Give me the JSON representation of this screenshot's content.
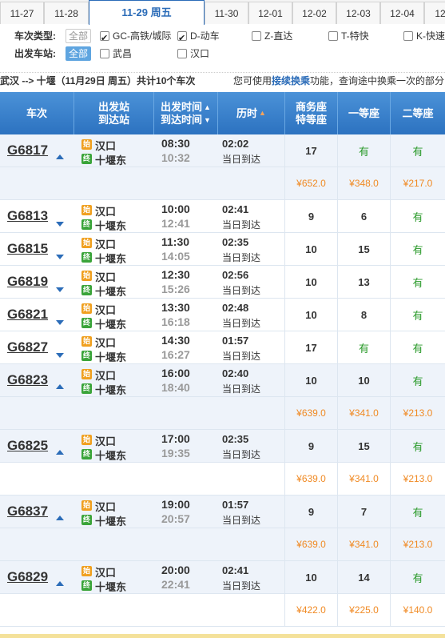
{
  "date_tabs": [
    {
      "label": "11-27",
      "active": false
    },
    {
      "label": "11-28",
      "active": false
    },
    {
      "label": "11-29 周五",
      "active": true
    },
    {
      "label": "11-30",
      "active": false
    },
    {
      "label": "12-01",
      "active": false
    },
    {
      "label": "12-02",
      "active": false
    },
    {
      "label": "12-03",
      "active": false
    },
    {
      "label": "12-04",
      "active": false
    },
    {
      "label": "12",
      "active": false
    }
  ],
  "filters": {
    "type_label": "车次类型:",
    "all_label": "全部",
    "types": [
      {
        "label": "GC-高铁/城际",
        "checked": true
      },
      {
        "label": "D-动车",
        "checked": true
      },
      {
        "label": "Z-直达",
        "checked": false
      },
      {
        "label": "T-特快",
        "checked": false
      },
      {
        "label": "K-快速",
        "checked": false
      }
    ],
    "station_label": "出发车站:",
    "station_all_label": "全部",
    "stations": [
      {
        "label": "武昌",
        "checked": false
      },
      {
        "label": "汉口",
        "checked": false
      }
    ]
  },
  "route": {
    "prefix": "武汉 --> 十堰（11月29日  周五）共计",
    "count": "10",
    "suffix": "个车次",
    "hint_pre": "您可使用",
    "hint_link": "接续换乘",
    "hint_post": "功能，查询途中换乘一次的部分"
  },
  "table": {
    "headers": {
      "train": "车次",
      "station_1": "出发站",
      "station_2": "到达站",
      "time_1": "出发时间",
      "time_2": "到达时间",
      "duration": "历时",
      "business_1": "商务座",
      "business_2": "特等座",
      "first": "一等座",
      "second": "二等座"
    },
    "trains": [
      {
        "no": "G6817",
        "arrow": "up",
        "from": "汉口",
        "to": "十堰东",
        "dep": "08:30",
        "arr": "10:32",
        "dur": "02:02",
        "day": "当日到达",
        "business": "17",
        "first": "有",
        "second": "有",
        "prices": [
          "¥652.0",
          "¥348.0",
          "¥217.0"
        ]
      },
      {
        "no": "G6813",
        "arrow": "down",
        "from": "汉口",
        "to": "十堰东",
        "dep": "10:00",
        "arr": "12:41",
        "dur": "02:41",
        "day": "当日到达",
        "business": "9",
        "first": "6",
        "second": "有"
      },
      {
        "no": "G6815",
        "arrow": "down",
        "from": "汉口",
        "to": "十堰东",
        "dep": "11:30",
        "arr": "14:05",
        "dur": "02:35",
        "day": "当日到达",
        "business": "10",
        "first": "15",
        "second": "有"
      },
      {
        "no": "G6819",
        "arrow": "down",
        "from": "汉口",
        "to": "十堰东",
        "dep": "12:30",
        "arr": "15:26",
        "dur": "02:56",
        "day": "当日到达",
        "business": "10",
        "first": "13",
        "second": "有"
      },
      {
        "no": "G6821",
        "arrow": "down",
        "from": "汉口",
        "to": "十堰东",
        "dep": "13:30",
        "arr": "16:18",
        "dur": "02:48",
        "day": "当日到达",
        "business": "10",
        "first": "8",
        "second": "有"
      },
      {
        "no": "G6827",
        "arrow": "down",
        "from": "汉口",
        "to": "十堰东",
        "dep": "14:30",
        "arr": "16:27",
        "dur": "01:57",
        "day": "当日到达",
        "business": "17",
        "first": "有",
        "second": "有"
      },
      {
        "no": "G6823",
        "arrow": "up",
        "from": "汉口",
        "to": "十堰东",
        "dep": "16:00",
        "arr": "18:40",
        "dur": "02:40",
        "day": "当日到达",
        "business": "10",
        "first": "10",
        "second": "有",
        "prices": [
          "¥639.0",
          "¥341.0",
          "¥213.0"
        ]
      },
      {
        "no": "G6825",
        "arrow": "up",
        "from": "汉口",
        "to": "十堰东",
        "dep": "17:00",
        "arr": "19:35",
        "dur": "02:35",
        "day": "当日到达",
        "business": "9",
        "first": "15",
        "second": "有",
        "prices": [
          "¥639.0",
          "¥341.0",
          "¥213.0"
        ]
      },
      {
        "no": "G6837",
        "arrow": "up",
        "from": "汉口",
        "to": "十堰东",
        "dep": "19:00",
        "arr": "20:57",
        "dur": "01:57",
        "day": "当日到达",
        "business": "9",
        "first": "7",
        "second": "有",
        "prices": [
          "¥639.0",
          "¥341.0",
          "¥213.0"
        ]
      },
      {
        "no": "G6829",
        "arrow": "up",
        "from": "汉口",
        "to": "十堰东",
        "dep": "20:00",
        "arr": "22:41",
        "dur": "02:41",
        "day": "当日到达",
        "business": "10",
        "first": "14",
        "second": "有",
        "prices": [
          "¥422.0",
          "¥225.0",
          "¥140.0"
        ]
      }
    ],
    "start_badge": "始",
    "end_badge": "终"
  },
  "colors": {
    "header_blue": "#2c72c0",
    "price_orange": "#f08a24",
    "available_green": "#2a9a2a",
    "start_badge": "#f0a020",
    "end_badge": "#3aa43a"
  }
}
